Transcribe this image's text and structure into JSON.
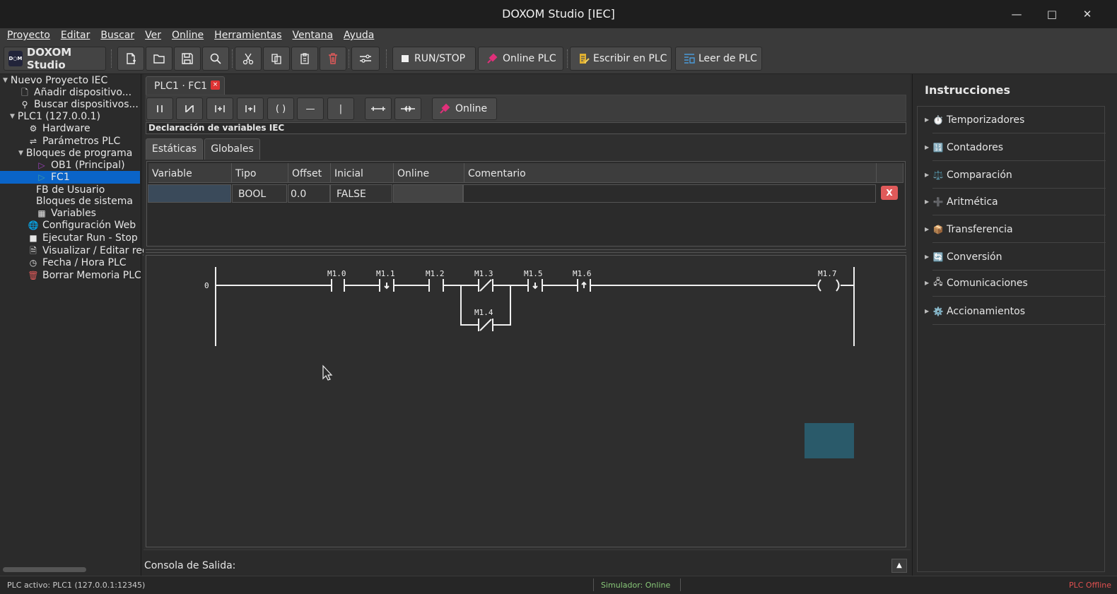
{
  "window": {
    "title": "DOXOM Studio [IEC]"
  },
  "menu": [
    "Proyecto",
    "Editar",
    "Buscar",
    "Ver",
    "Online",
    "Herramientas",
    "Ventana",
    "Ayuda"
  ],
  "toolbar": {
    "app_name": "DOXOM Studio",
    "logo_mark": "D○M",
    "run_stop": "RUN/STOP",
    "online_plc": "Online PLC",
    "write_plc": "Escribir en PLC",
    "read_plc": "Leer de PLC"
  },
  "tree": {
    "project": "Nuevo Proyecto IEC",
    "add_device": "Añadir dispositivo...",
    "search_devices": "Buscar dispositivos...",
    "plc": "PLC1 (127.0.0.1)",
    "hardware": "Hardware",
    "params": "Parámetros PLC",
    "blocks": "Bloques de programa",
    "ob1": "OB1 (Principal)",
    "fc1": "FC1",
    "fb_user": "FB de Usuario",
    "sys_blocks": "Bloques de sistema",
    "variables": "Variables",
    "web": "Configuración Web",
    "runstop": "Ejecutar Run - Stop",
    "registers": "Visualizar / Editar regis",
    "datetime": "Fecha / Hora PLC",
    "erase": "Borrar Memoria PLC"
  },
  "editor": {
    "tab": "PLC1 · FC1",
    "tab_close": "×",
    "ladder_toolbar": {
      "online": "Online",
      "coil": "( )",
      "hline": "—",
      "vline": "|"
    },
    "decl_header": "Declaración de variables IEC",
    "var_tabs": [
      "Estáticas",
      "Globales"
    ],
    "columns": [
      "Variable",
      "Tipo",
      "Offset",
      "Inicial",
      "Online",
      "Comentario"
    ],
    "rows": [
      {
        "variable": "",
        "tipo": "BOOL",
        "offset": "0.0",
        "inicial": "FALSE",
        "online": "",
        "comentario": "",
        "delete": "X"
      }
    ]
  },
  "ladder": {
    "network_number": "0",
    "contacts": [
      "M1.0",
      "M1.1",
      "M1.2",
      "M1.3",
      "M1.4",
      "M1.5",
      "M1.6"
    ],
    "coil": "M1.7"
  },
  "console": {
    "label": "Consola de Salida:",
    "toggle": "▲"
  },
  "instructions": {
    "header": "Instrucciones",
    "categories": [
      {
        "icon": "⏱️",
        "label": "Temporizadores"
      },
      {
        "icon": "🔢",
        "label": "Contadores"
      },
      {
        "icon": "⚖️",
        "label": "Comparación"
      },
      {
        "icon": "➕",
        "label": "Aritmética"
      },
      {
        "icon": "📦",
        "label": "Transferencia"
      },
      {
        "icon": "🔄",
        "label": "Conversión"
      },
      {
        "icon": "🖧",
        "label": "Comunicaciones"
      },
      {
        "icon": "⚙️",
        "label": "Accionamientos"
      }
    ]
  },
  "status": {
    "active_plc": "PLC activo: PLC1  (127.0.0.1:12345)",
    "simulator": "Simulador: Online",
    "plc_state": "PLC Offline"
  },
  "colors": {
    "selection": "#0a64c8",
    "accent_red": "#e05a5a",
    "online_pink": "#e0307a",
    "status_green": "#88c878"
  }
}
